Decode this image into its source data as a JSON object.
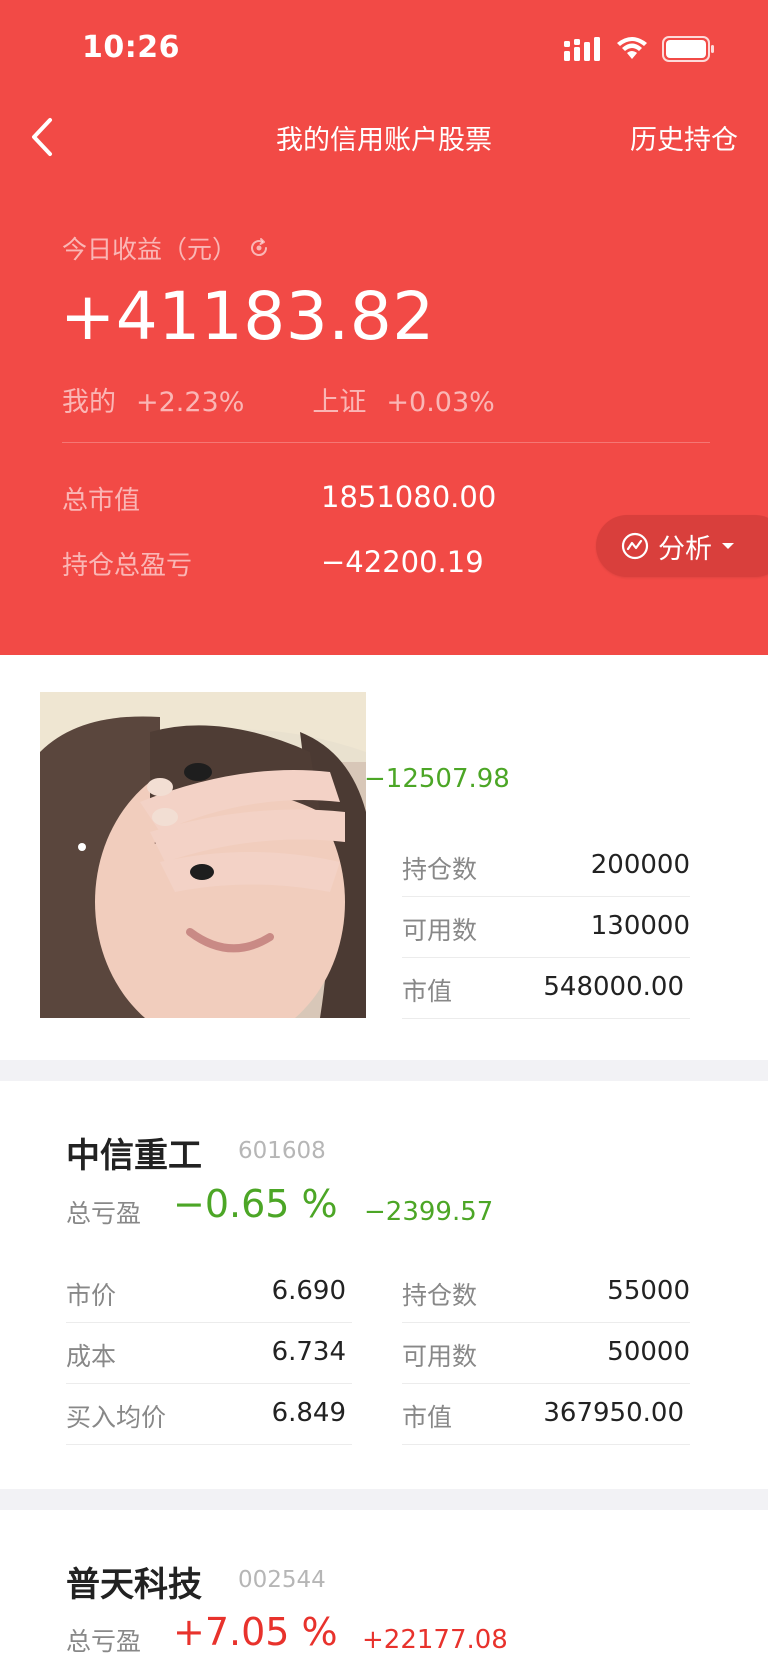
{
  "status": {
    "time": "10:26"
  },
  "nav": {
    "title": "我的信用账户股票",
    "history": "历史持仓"
  },
  "summary": {
    "today_label": "今日收益（元）",
    "today_value": "+41183.82",
    "mine_label": "我的",
    "mine_pct": "+2.23%",
    "sh_label": "上证",
    "sh_pct": "+0.03%",
    "total_mv_label": "总市值",
    "total_mv": "1851080.00",
    "total_pl_label": "持仓总盈亏",
    "total_pl": "−42200.19",
    "analysis": "分析"
  },
  "holdings": [
    {
      "pl_amount": "−12507.98",
      "rows": [
        {
          "label": "持仓数",
          "value": "200000"
        },
        {
          "label": "可用数",
          "value": "130000"
        },
        {
          "label": "市值",
          "value": "548000.00"
        }
      ]
    },
    {
      "name": "中信重工",
      "code": "601608",
      "pl_label": "总亏盈",
      "pl_pct": "−0.65 %",
      "pl_amount": "−2399.57",
      "left_rows": [
        {
          "label": "市价",
          "value": "6.690"
        },
        {
          "label": "成本",
          "value": "6.734"
        },
        {
          "label": "买入均价",
          "value": "6.849"
        }
      ],
      "right_rows": [
        {
          "label": "持仓数",
          "value": "55000"
        },
        {
          "label": "可用数",
          "value": "50000"
        },
        {
          "label": "市值",
          "value": "367950.00"
        }
      ]
    },
    {
      "name": "普天科技",
      "code": "002544",
      "pl_label": "总亏盈",
      "pl_pct": "+7.05 %",
      "pl_amount": "+22177.08"
    }
  ],
  "colors": {
    "header_bg": "#f24a46",
    "loss": "#4ca626",
    "gain": "#e8322c"
  }
}
